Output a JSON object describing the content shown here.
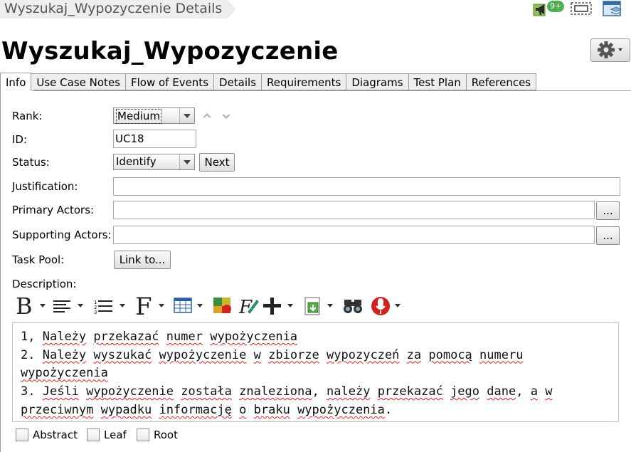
{
  "breadcrumb": {
    "text": "Wyszukaj_Wypozyczenie Details"
  },
  "notifications": {
    "badge": "9+"
  },
  "page": {
    "title": "Wyszukaj_Wypozyczenie"
  },
  "tabs": [
    {
      "label": "Info",
      "active": true
    },
    {
      "label": "Use Case Notes"
    },
    {
      "label": "Flow of Events"
    },
    {
      "label": "Details"
    },
    {
      "label": "Requirements"
    },
    {
      "label": "Diagrams"
    },
    {
      "label": "Test Plan"
    },
    {
      "label": "References"
    }
  ],
  "form": {
    "rank": {
      "label": "Rank:",
      "value": "Medium"
    },
    "id": {
      "label": "ID:",
      "value": "UC18"
    },
    "status": {
      "label": "Status:",
      "value": "Identify",
      "next_label": "Next"
    },
    "justification": {
      "label": "Justification:",
      "value": ""
    },
    "primary_actors": {
      "label": "Primary Actors:",
      "value": "",
      "browse_label": "..."
    },
    "supporting_actors": {
      "label": "Supporting Actors:",
      "value": "",
      "browse_label": "..."
    },
    "task_pool": {
      "label": "Task Pool:",
      "link_label": "Link to..."
    },
    "description": {
      "label": "Description:"
    }
  },
  "toolbar": {
    "items": [
      "bold-icon",
      "align-icon",
      "list-icon",
      "font-icon",
      "table-icon",
      "color-icon",
      "formula-icon",
      "insert-icon",
      "export-icon",
      "find-icon",
      "spellcheck-icon"
    ]
  },
  "description": {
    "lines": [
      "1, Należy przekazać numer wypożyczenia",
      "2. Należy wyszukać wypożyczenie w zbiorze wypozyczeń za pomocą numeru wypożyczenia",
      "3. Jeśli wypożyczenie została znaleziona, należy przekazać jego dane, a w przeciwnym wypadku informację o braku wypożyczenia."
    ]
  },
  "flags": {
    "abstract": {
      "label": "Abstract",
      "checked": false
    },
    "leaf": {
      "label": "Leaf",
      "checked": false
    },
    "root": {
      "label": "Root",
      "checked": false
    }
  },
  "colors": {
    "badge": "#4caf50",
    "spellcheck_underline": "#e02020"
  }
}
